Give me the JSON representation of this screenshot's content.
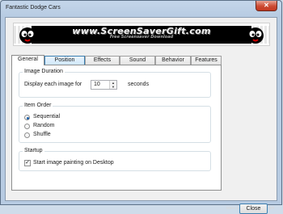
{
  "window": {
    "title": "Fantastic Dodge Cars",
    "close_glyph": "✕"
  },
  "banner": {
    "main_text": "www.ScreenSaverGift.com",
    "sub_text": "Free Screensaver Download"
  },
  "tabs": [
    {
      "label": "General",
      "active": true
    },
    {
      "label": "Position",
      "active": false
    },
    {
      "label": "Effects",
      "active": false
    },
    {
      "label": "Sound",
      "active": false
    },
    {
      "label": "Behavior",
      "active": false
    },
    {
      "label": "Features",
      "active": false
    }
  ],
  "image_duration": {
    "group_label": "Image Duration",
    "display_label": "Display each image for",
    "value": "10",
    "unit": "seconds"
  },
  "item_order": {
    "group_label": "Item Order",
    "options": [
      {
        "label": "Sequential",
        "selected": true
      },
      {
        "label": "Random",
        "selected": false
      },
      {
        "label": "Shuffle",
        "selected": false
      }
    ]
  },
  "startup": {
    "group_label": "Startup",
    "option_label": "Start image painting on Desktop",
    "checked": true,
    "check_glyph": "✓"
  },
  "buttons": {
    "close": "Close"
  },
  "watermark": "www.ScreenSaverGift.com"
}
